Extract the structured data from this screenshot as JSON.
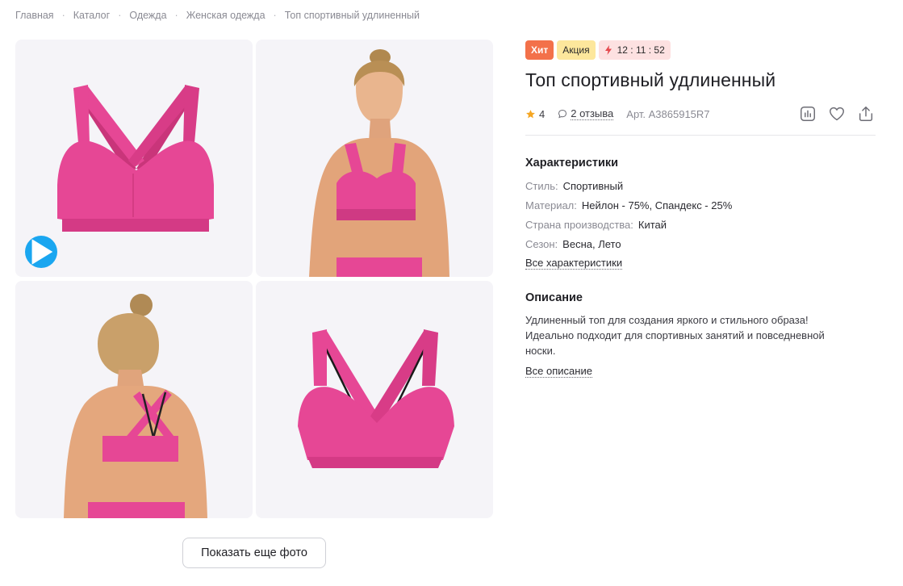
{
  "breadcrumb": [
    "Главная",
    "Каталог",
    "Одежда",
    "Женская одежда",
    "Топ спортивный удлиненный"
  ],
  "badges": {
    "hit": "Хит",
    "sale": "Акция",
    "timer": "12 : 11 : 52"
  },
  "product": {
    "title": "Топ спортивный удлиненный",
    "rating": "4",
    "reviews": "2 отзыва",
    "sku": "Арт. A3865915R7"
  },
  "specs": {
    "title": "Характеристики",
    "items": [
      {
        "key": "Стиль:",
        "value": "Спортивный"
      },
      {
        "key": "Материал:",
        "value": "Нейлон - 75%, Спандекс - 25%"
      },
      {
        "key": "Страна производства:",
        "value": "Китай"
      },
      {
        "key": "Сезон:",
        "value": "Весна, Лето"
      }
    ],
    "all_link": "Все характеристики"
  },
  "description": {
    "title": "Описание",
    "text": "Удлиненный топ для создания яркого и стильного образа! Идеально подходит для спортивных занятий и повседневной носки.",
    "all_link": "Все описание"
  },
  "gallery": {
    "more_button": "Показать еще фото"
  },
  "colors": {
    "product_pink": "#e64795",
    "play": "#1aa6f0",
    "hit": "#f3714a",
    "sale": "#fde79c",
    "timer_bg": "#fde1e1",
    "star": "#f5a623"
  },
  "icons": [
    "play-icon",
    "star-icon",
    "comment-icon",
    "lightning-icon",
    "compare-icon",
    "heart-icon",
    "share-icon"
  ]
}
